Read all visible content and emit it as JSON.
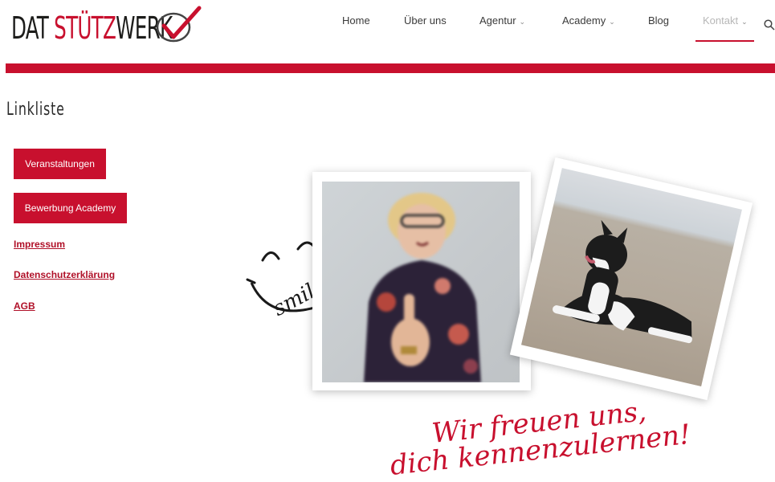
{
  "brand": {
    "part1": "DAT ",
    "part2": "STÜTZ",
    "part3": "WERK"
  },
  "nav": [
    {
      "label": "Home"
    },
    {
      "label": "Über uns"
    },
    {
      "label": "Agentur",
      "dropdown": true
    },
    {
      "label": "Academy",
      "dropdown": true
    },
    {
      "label": "Blog"
    },
    {
      "label": "Kontakt",
      "dropdown": true,
      "active": true
    }
  ],
  "page": {
    "title": "Linkliste"
  },
  "buttons": {
    "events": "Veranstaltungen",
    "application": "Bewerbung Academy"
  },
  "links": {
    "imprint": "Impressum",
    "privacy": "Datenschutzerklärung",
    "terms": "AGB"
  },
  "graphics": {
    "smile_text": "smile"
  },
  "tagline": {
    "line1": "Wir freuen uns,",
    "line2": "dich kennenzulernen!"
  },
  "colors": {
    "accent": "#c8102e"
  }
}
